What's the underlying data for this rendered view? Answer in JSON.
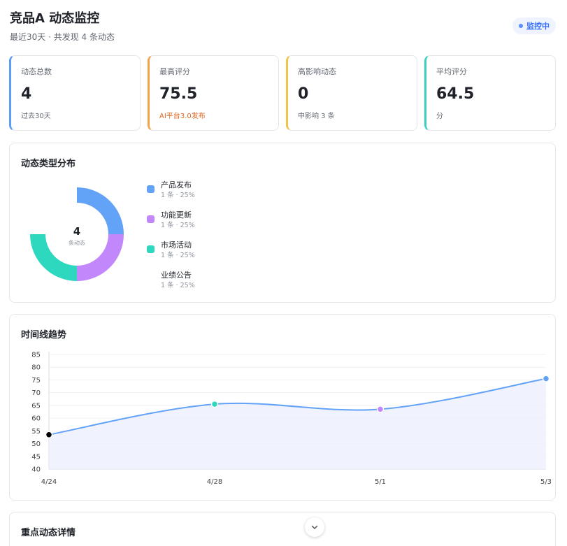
{
  "header": {
    "title": "竞品A 动态监控",
    "subtitle": "最近30天 · 共发现 4 条动态",
    "badge": "监控中"
  },
  "stats": [
    {
      "label": "动态总数",
      "value": "4",
      "sub": "过去30天",
      "accent": "#5b9cf6",
      "sub_color": "#646a73"
    },
    {
      "label": "最高评分",
      "value": "75.5",
      "sub": "AI平台3.0发布",
      "accent": "#f0a34b",
      "sub_color": "#e0651f"
    },
    {
      "label": "高影响动态",
      "value": "0",
      "sub": "中影响 3 条",
      "accent": "#f2c443",
      "sub_color": "#646a73"
    },
    {
      "label": "平均评分",
      "value": "64.5",
      "sub": "分",
      "accent": "#3ad0bf",
      "sub_color": "#646a73"
    }
  ],
  "distribution": {
    "title": "动态类型分布",
    "total": "4",
    "total_label": "条动态",
    "items": [
      {
        "name": "产品发布",
        "meta": "1 条 · 25%",
        "color": "#62a3f7"
      },
      {
        "name": "功能更新",
        "meta": "1 条 · 25%",
        "color": "#c287fb"
      },
      {
        "name": "市场活动",
        "meta": "1 条 · 25%",
        "color": "#2ed8be"
      },
      {
        "name": "业绩公告",
        "meta": "1 条 · 25%",
        "color": ""
      }
    ]
  },
  "timeline": {
    "title": "时间线趋势"
  },
  "chart_data": {
    "type": "line",
    "x": [
      "4/24",
      "4/28",
      "5/1",
      "5/3"
    ],
    "values": [
      53.5,
      65.5,
      63.5,
      75.5
    ],
    "point_colors": [
      "#000000",
      "#2ed8be",
      "#c287fb",
      "#62a3f7"
    ],
    "ylim": [
      40,
      85
    ],
    "yticks": [
      40,
      45,
      50,
      55,
      60,
      65,
      70,
      75,
      80,
      85
    ],
    "grid": true,
    "line_color": "#62a3f7",
    "fill_color": "#eceffc"
  },
  "details": {
    "title": "重点动态详情"
  }
}
